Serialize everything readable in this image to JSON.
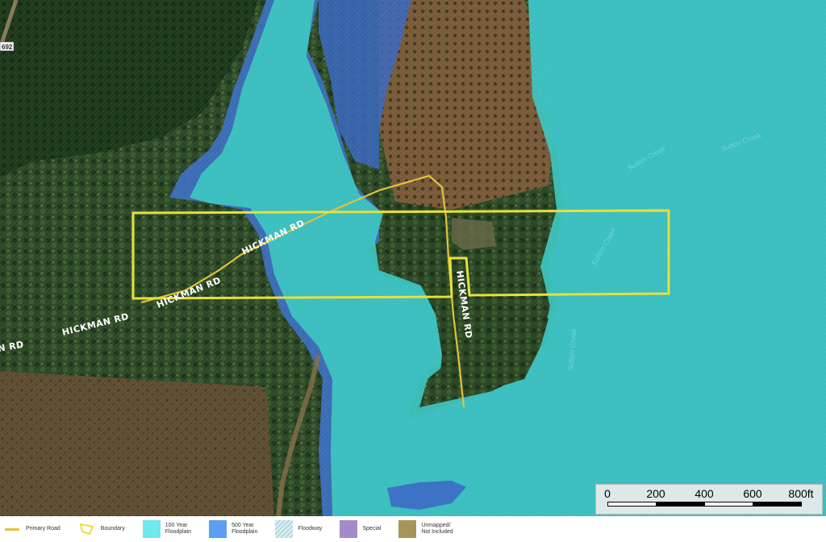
{
  "map": {
    "road_labels": [
      {
        "id": "hickman-rd-1",
        "text": "HICKMAN RD"
      },
      {
        "id": "hickman-rd-2",
        "text": "HICKMAN RD"
      },
      {
        "id": "hickman-rd-3",
        "text": "HICKMAN RD"
      },
      {
        "id": "hickman-rd-4",
        "text": "HICKMAN RD"
      },
      {
        "id": "hickman-rd-5",
        "text": "N RD"
      }
    ],
    "route_badge": "692",
    "creek_labels": [
      "Sutton Creek",
      "Sutton Creek",
      "Sutton Creek",
      "Sutton Creek"
    ],
    "colors": {
      "forest_dark": "#1f3a1c",
      "forest_mid": "#2f4d27",
      "field_brown": "#5b4a2e",
      "floodplain_100": "#3fc6c2",
      "floodplain_500": "#3d73c9",
      "boundary": "#e8e03a",
      "primary_road": "#e4c23b"
    }
  },
  "scale_bar": {
    "ticks": [
      "0",
      "200",
      "400",
      "600",
      "800ft"
    ]
  },
  "legend": {
    "items": [
      {
        "key": "primary_road",
        "label": "Primary Road",
        "icon": "line-icon",
        "color": "#e4c23b"
      },
      {
        "key": "boundary",
        "label": "Boundary",
        "icon": "boundary-icon",
        "color": "#e8e03a"
      },
      {
        "key": "fp100",
        "label": "100 Year\nFloodplain",
        "icon": "swatch-icon",
        "color": "#6fe8ee"
      },
      {
        "key": "fp500",
        "label": "500 Year\nFloodplain",
        "icon": "swatch-icon",
        "color": "#5aa0f0"
      },
      {
        "key": "floodway",
        "label": "Floodway",
        "icon": "hatch-icon",
        "color": "#a9d8e0"
      },
      {
        "key": "special",
        "label": "Special",
        "icon": "swatch-icon",
        "color": "#a48ac9"
      },
      {
        "key": "unmapped",
        "label": "Unmapped/\nNot Included",
        "icon": "swatch-icon",
        "color": "#a8935a"
      }
    ]
  }
}
